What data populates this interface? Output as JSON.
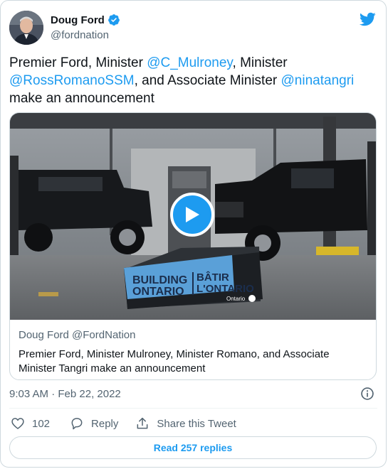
{
  "author": {
    "name": "Doug Ford",
    "handle": "@fordnation"
  },
  "tweet": {
    "text_parts": [
      {
        "text": "Premier Ford, Minister ",
        "mention": false
      },
      {
        "text": "@C_Mulroney",
        "mention": true
      },
      {
        "text": ", Minister ",
        "mention": false
      },
      {
        "text": "@RossRomanoSSM",
        "mention": true
      },
      {
        "text": ", and Associate Minister ",
        "mention": false
      },
      {
        "text": "@ninatangri",
        "mention": true
      },
      {
        "text": " make an announcement",
        "mention": false
      }
    ]
  },
  "media": {
    "banner_line1_en": "BUILDING",
    "banner_line2_en": "ONTARIO",
    "banner_line1_fr": "BÂTIR",
    "banner_line2_fr": "L'ONTARIO",
    "banner_logo": "Ontario",
    "link_site": "Doug Ford @FordNation",
    "link_description": "Premier Ford, Minister Mulroney, Minister Romano, and Associate Minister Tangri make an announcement"
  },
  "meta": {
    "timestamp": "9:03 AM · Feb 22, 2022"
  },
  "actions": {
    "like_count": "102",
    "reply_label": "Reply",
    "share_label": "Share this Tweet"
  },
  "read_replies_label": "Read 257 replies",
  "colors": {
    "accent": "#1d9bf0",
    "secondary_text": "#536471",
    "border": "#cfd9de"
  },
  "icons": [
    "twitter-bird-icon",
    "verified-badge-icon",
    "play-icon",
    "info-icon",
    "heart-icon",
    "reply-icon",
    "share-icon"
  ]
}
